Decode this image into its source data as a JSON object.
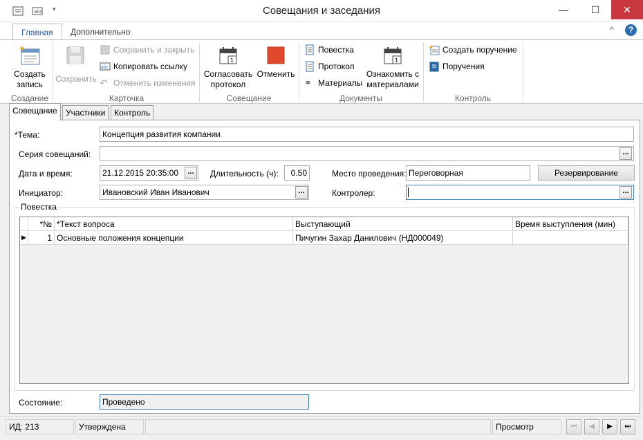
{
  "window": {
    "title": "Совещания и заседания"
  },
  "ribbon_tabs": [
    "Главная",
    "Дополнительно"
  ],
  "ribbon": {
    "create": {
      "label1": "Создать",
      "label2": "запись",
      "group": "Создание"
    },
    "card": {
      "save": "Сохранить",
      "save_close": "Сохранить и закрыть",
      "copy_link": "Копировать ссылку",
      "undo": "Отменить изменения",
      "group": "Карточка"
    },
    "meeting": {
      "approve1": "Согласовать",
      "approve2": "протокол",
      "cancel": "Отменить",
      "group": "Совещание"
    },
    "docs": {
      "agenda": "Повестка",
      "protocol": "Протокол",
      "materials": "Материалы",
      "acquaint1": "Ознакомить с",
      "acquaint2": "материалами",
      "group": "Документы"
    },
    "control": {
      "create_task": "Создать поручение",
      "tasks": "Поручения",
      "group": "Контроль"
    }
  },
  "form_tabs": [
    "Совещание",
    "Участники",
    "Контроль"
  ],
  "form": {
    "topic_label": "*Тема:",
    "topic_value": "Концепция развития компании",
    "series_label": "Серия совещаний:",
    "series_value": "",
    "datetime_label": "Дата и время:",
    "datetime_value": "21.12.2015 20:35:00",
    "duration_label": "Длительность (ч):",
    "duration_value": "0.50",
    "place_label": "Место проведения:",
    "place_value": "Переговорная",
    "reserve_button": "Резервирование",
    "initiator_label": "Инициатор:",
    "initiator_value": "Ивановский Иван Иванович",
    "controller_label": "Контролер:",
    "controller_value": "",
    "state_label": "Состояние:",
    "state_value": "Проведено",
    "dots": "..."
  },
  "agenda": {
    "title": "Повестка",
    "columns": [
      "*№",
      "*Текст вопроса",
      "Выступающий",
      "Время выступления (мин)"
    ],
    "rows": [
      {
        "num": "1",
        "text": "Основные положения концепции",
        "speaker": "Пичугин Захар Данилович (НД000049)",
        "time": ""
      }
    ]
  },
  "statusbar": {
    "id": "ИД: 213",
    "status": "Утверждена",
    "mode": "Просмотр",
    "nav": [
      "⏮",
      "◀",
      "▶",
      "⏭"
    ]
  },
  "colors": {
    "accent": "#2a5aa0",
    "close": "#c7373d",
    "help": "#2b6cb3",
    "stop": "#e0482b"
  },
  "icons": [
    "app-menu-icon",
    "abc-icon",
    "dropdown-icon",
    "minimize-icon",
    "maximize-icon",
    "close-icon",
    "collapse-ribbon-icon",
    "help-icon"
  ]
}
